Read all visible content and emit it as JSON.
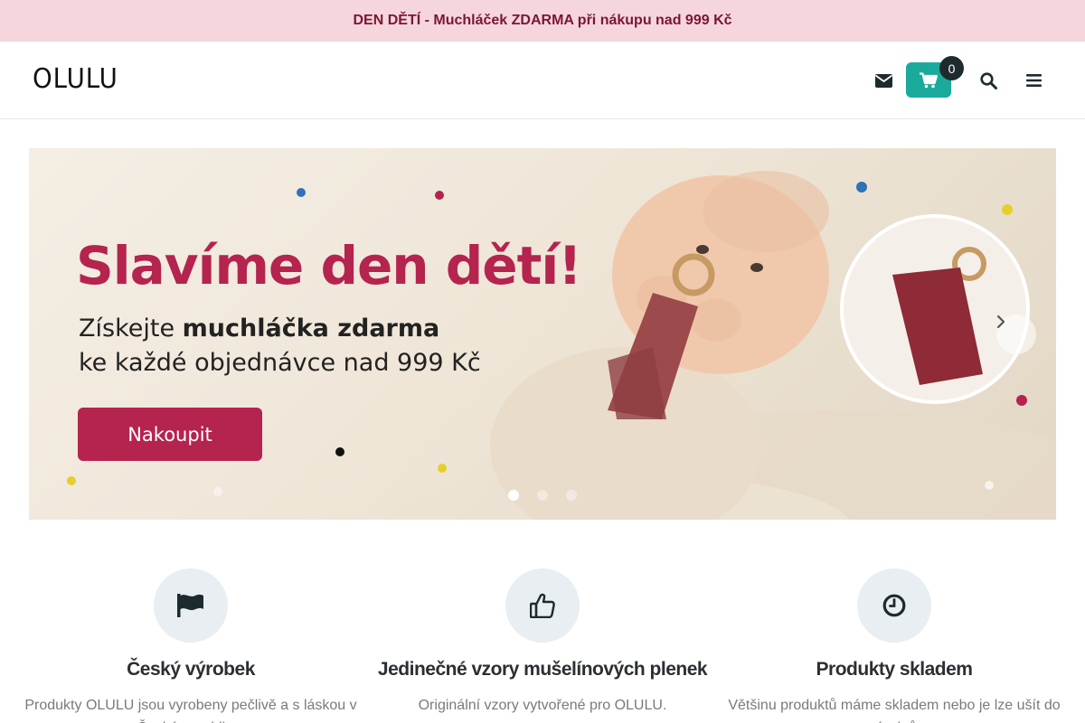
{
  "promo": {
    "text": "DEN DĚTÍ - Muchláček ZDARMA při nákupu nad 999 Kč"
  },
  "header": {
    "logo": "OLULU",
    "cart_count": "0",
    "icons": [
      "envelope-icon",
      "cart-icon",
      "search-icon",
      "menu-icon"
    ],
    "accent_color": "#1aaa9c"
  },
  "banner": {
    "title": "Slavíme den dětí!",
    "line1_prefix": "Získejte ",
    "line1_bold": "muchláčka zdarma",
    "line2": "ke každé objednávce nad 999 Kč",
    "cta": "Nakoupit",
    "brand_color": "#b5234f",
    "slides_total": 3,
    "active_slide": 1
  },
  "features": [
    {
      "icon": "flag-icon",
      "title": "Český výrobek",
      "text": "Produkty OLULU jsou vyrobeny pečlivě a s láskou v České republice."
    },
    {
      "icon": "thumbs-up-icon",
      "title": "Jedinečné vzory mušelínových plenek",
      "text": "Originální vzory vytvořené pro OLULU."
    },
    {
      "icon": "clock-icon",
      "title": "Produkty skladem",
      "text": "Většinu produktů máme skladem nebo je lze ušít do pár dnů."
    }
  ]
}
